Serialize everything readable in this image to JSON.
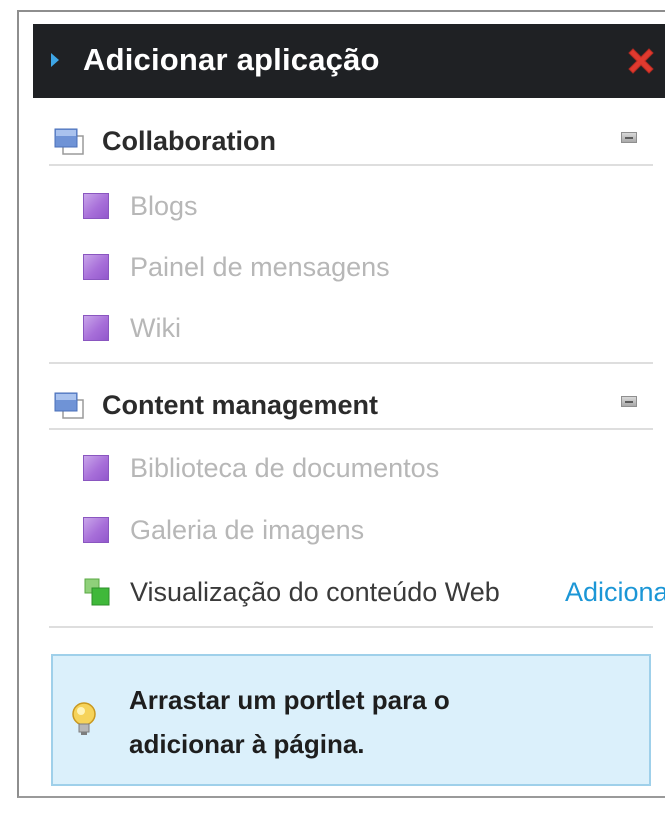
{
  "window": {
    "title": "Adicionar aplicação",
    "close_icon": "close-x-icon",
    "title_bg": "#1f2124",
    "close_color": "#e03a2f"
  },
  "categories": [
    {
      "label": "Collaboration",
      "icon": "category-window-icon",
      "items": [
        {
          "label": "Blogs",
          "icon": "portlet-icon"
        },
        {
          "label": "Painel de mensagens",
          "icon": "portlet-icon"
        },
        {
          "label": "Wiki",
          "icon": "portlet-icon"
        }
      ]
    },
    {
      "label": "Content management",
      "icon": "category-window-icon",
      "items": [
        {
          "label": "Biblioteca de documentos",
          "icon": "portlet-icon"
        },
        {
          "label": "Galeria de imagens",
          "icon": "portlet-icon"
        },
        {
          "label": "Visualização do conteúdo Web",
          "icon": "web-content-icon",
          "action": "Adicionar"
        }
      ]
    }
  ],
  "tip": {
    "icon": "lightbulb-icon",
    "text_line1": "Arrastar um portlet para o",
    "text_line2": "adicionar à página."
  },
  "colors": {
    "link": "#1b96d6",
    "disabled_text": "#b7b7b7",
    "tip_bg": "#dbf0fb"
  }
}
